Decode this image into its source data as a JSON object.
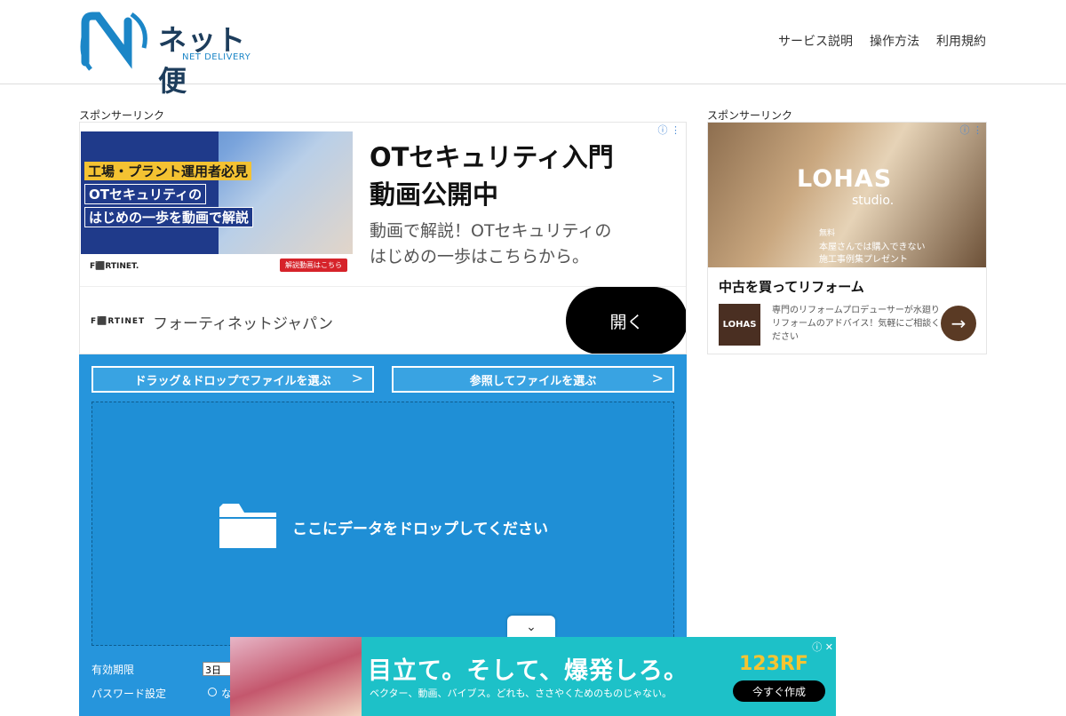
{
  "header": {
    "logo_text": "ネット便",
    "logo_sub": "NET DELIVERY",
    "nav": [
      "サービス説明",
      "操作方法",
      "利用規約"
    ]
  },
  "sponsor_label": "スポンサーリンク",
  "main_ad": {
    "img_tags": [
      "工場・プラント運用者必見",
      "OTセキュリティの",
      "はじめの一歩を動画で解説"
    ],
    "img_logo": "F⬛RTINET.",
    "img_cta": "解説動画はこちら",
    "title_line1": "OTセキュリティ入門",
    "title_line2": "動画公開中",
    "desc_line1": "動画で解説！OTセキュリティの",
    "desc_line2": "はじめの一歩はこちらから。",
    "brand_logo": "F⬛RTINET",
    "brand_name": "フォーティネットジャパン",
    "open_label": "開く",
    "info_icon": "info-icon"
  },
  "upload": {
    "drag_button": "ドラッグ＆ドロップでファイルを選ぶ",
    "browse_button": "参照してファイルを選ぶ",
    "drop_text": "ここにデータをドロップしてください",
    "expire_label": "有効期限",
    "expire_value": "3日",
    "password_label": "パスワード設定",
    "password_option": "な"
  },
  "side_ad": {
    "img_title": "LOHAS",
    "img_studio": "studio.",
    "img_sub1": "無料",
    "img_sub2": "本屋さんでは購入できない",
    "img_sub3": "施工事例集プレゼント",
    "title": "中古を買ってリフォーム",
    "logo": "LOHAS",
    "desc": "専門のリフォームプロデューサーが水廻りリフォームのアドバイス！気軽にご相談ください"
  },
  "bottom_ad": {
    "headline": "目立て。そして、爆発しろ。",
    "subline": "ベクター、動画、バイブス。どれも、ささやくためのものじゃない。",
    "brand": "123RF",
    "cta": "今すぐ作成"
  },
  "colors": {
    "upload_bg": "#2695dc",
    "logo_blue": "#1b86c7",
    "bottom_ad_bg": "#1dc1c8"
  }
}
